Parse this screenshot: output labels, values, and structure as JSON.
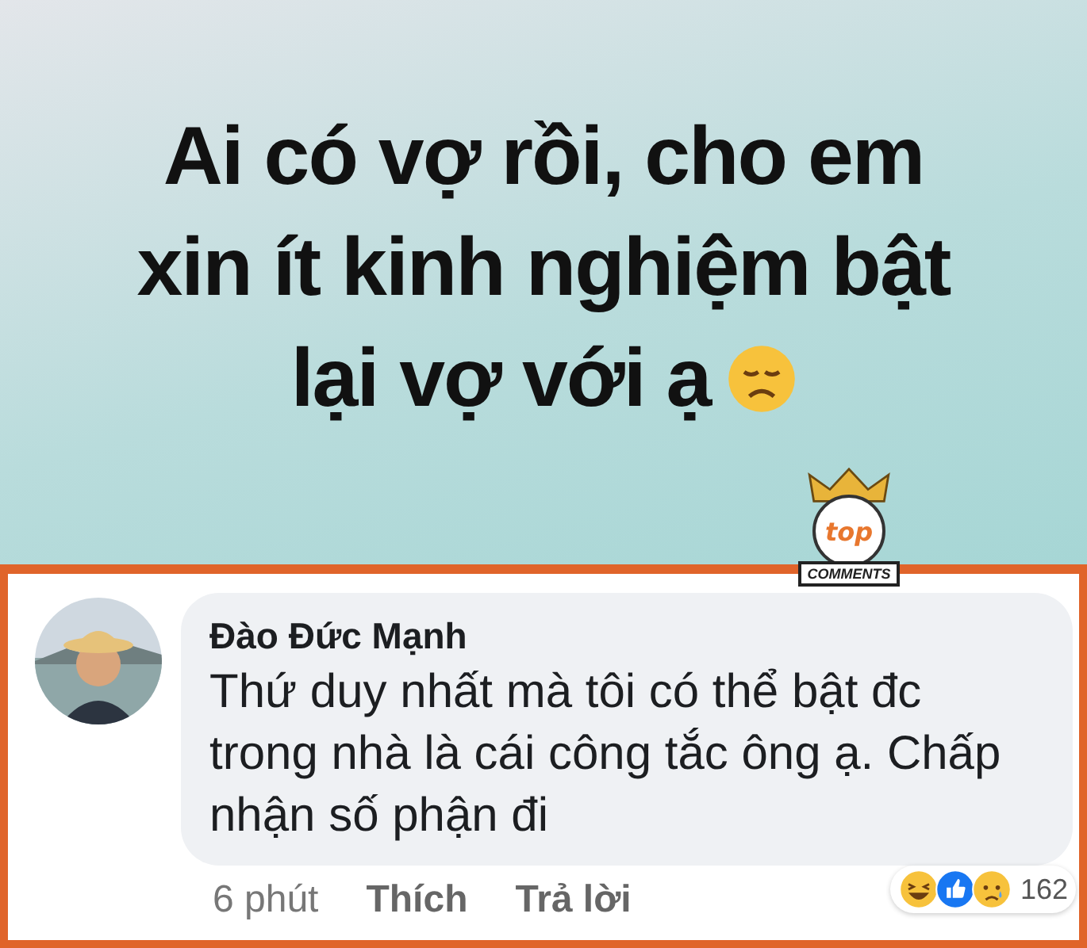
{
  "post": {
    "lines": [
      "Ai có vợ rồi, cho em",
      "xin ít kinh nghiệm bật",
      "lại vợ với ạ"
    ]
  },
  "badge": {
    "top": "top",
    "bottom": "COMMENTS"
  },
  "comment": {
    "author": "Đào Đức Mạnh",
    "text": "Thứ duy nhất mà tôi có thể bật đc trong nhà là cái công tắc ông ạ. Chấp nhận số phận đi",
    "time": "6 phút",
    "actions": [
      "Thích",
      "Trả lời"
    ],
    "reaction_count": "162"
  }
}
